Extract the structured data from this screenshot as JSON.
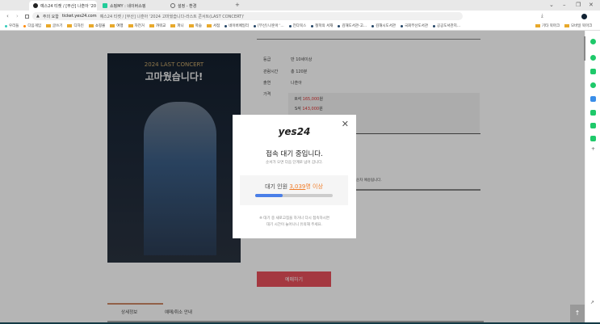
{
  "browser": {
    "tabs": [
      {
        "label": "예스24 티켓 / [부산] 나훈아 '20",
        "active": true
      },
      {
        "label": "쇼핑MY : 네이버쇼핑",
        "active": false
      },
      {
        "label": "설정 - 환경",
        "active": false
      }
    ],
    "new_tab": "+",
    "window_controls": [
      "⌄",
      "–",
      "❐",
      "✕"
    ],
    "security_label": "주의 요함",
    "url": "ticket.yes24.com",
    "page_title": "예스24 티켓 / [부산] 나훈아 '2024 고마웠습니다-라스트 콘서트(LAST CONCERT)'",
    "bookmarks": [
      "우리들",
      "다음게임",
      "글쓰기",
      "디자인",
      "쇼핑몰",
      "여행",
      "자전거",
      "까워교",
      "파니",
      "학습",
      "서점",
      "네이버페일리",
      "[부산] 나훈아 '...",
      "전다북스",
      "철학의 서재",
      "김해도서관-고...",
      "김해시도서관",
      "국회부산도서관",
      "공공도서관지..."
    ],
    "bookmark_folders": [
      "기타 북마크",
      "모바일 북마크"
    ]
  },
  "poster": {
    "subtitle": "2024 LAST CONCERT",
    "title": "고마웠습니다!"
  },
  "details": {
    "rows": [
      {
        "label": "등급",
        "value": "만 10세이상"
      },
      {
        "label": "관람시간",
        "value": "총 120분"
      },
      {
        "label": "출연",
        "value": "나훈아"
      },
      {
        "label": "가격",
        "value": ""
      }
    ],
    "prices": [
      {
        "seat": "R석",
        "amount": "165,000",
        "unit": "원"
      },
      {
        "seat": "S석",
        "amount": "143,000",
        "unit": "원"
      }
    ],
    "notice_fragment": "순차 예송됩니다."
  },
  "book_button": "예매하기",
  "detail_tabs": [
    "상세정보",
    "예매/취소 안내"
  ],
  "modal": {
    "logo": "yes24",
    "close": "✕",
    "title": "접속 대기 중입니다.",
    "subtitle": "순서가 오면 다음 단계로 넘어 갑니다.",
    "queue_label": "대기 인원",
    "queue_count": "3,039",
    "queue_suffix": "명 이상",
    "progress_percent": 35,
    "note_line1": "※ 대기 중 새로고침을 하거나 다시 접속하시면",
    "note_line2": "대기 시간이 늘어나니 유의해 주세요."
  },
  "scroll_top": "↑",
  "colors": {
    "accent": "#e8505b",
    "progress": "#4a7fe8",
    "queue": "#f07c28",
    "price": "#d33333"
  }
}
